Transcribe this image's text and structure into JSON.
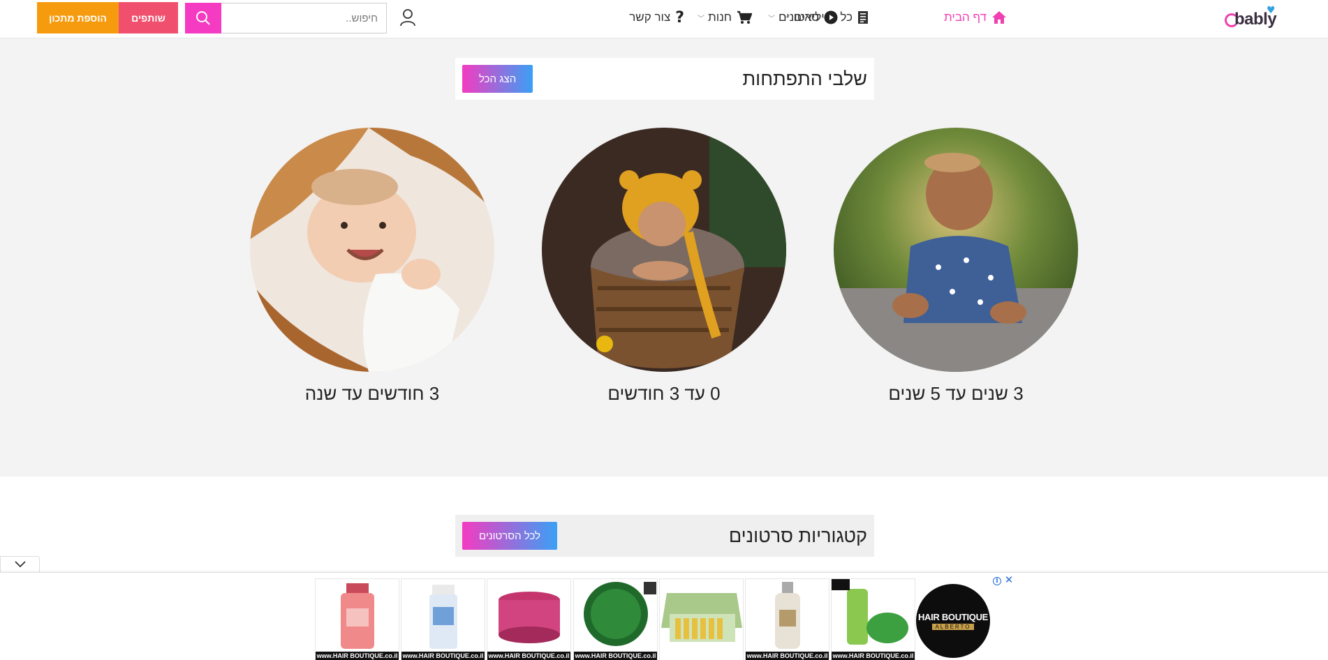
{
  "header": {
    "logo_text": "bably",
    "nav": {
      "home": "דף הבית",
      "all_stickers": "כל הגיליאים",
      "videos": "סרטונים",
      "store": "חנות",
      "contact": "צור קשר"
    },
    "search_placeholder": "חיפוש..",
    "partners_label": "שותפים",
    "add_recipe_label": "הוספת מתכון"
  },
  "development_stages": {
    "title": "שלבי התפתחות",
    "show_all_label": "הצג הכל",
    "items": [
      {
        "label": "3 שנים עד 5 שנים"
      },
      {
        "label": "0 עד 3 חודשים"
      },
      {
        "label": "3 חודשים עד שנה"
      }
    ]
  },
  "video_categories": {
    "title": "קטגוריות סרטונים",
    "all_videos_label": "לכל הסרטונים"
  },
  "ad": {
    "strip_text": "www.HAIR BOUTIQUE.co.il",
    "logo_line1": "HAIR BOUTIQUE",
    "logo_line2": "ALBERTO",
    "info_glyph": "i",
    "close_glyph": "✕"
  },
  "colors": {
    "brand_pink": "#f43bc1",
    "partners_red": "#f0506e",
    "add_orange": "#f69b0e",
    "gradient_blue": "#3aa0f5"
  },
  "icons": {
    "home": "home-icon",
    "stickers": "document-icon",
    "videos": "play-circle-icon",
    "store": "cart-icon",
    "contact": "question-icon",
    "user": "user-icon",
    "search": "search-icon",
    "collapse": "chevron-down-icon"
  }
}
